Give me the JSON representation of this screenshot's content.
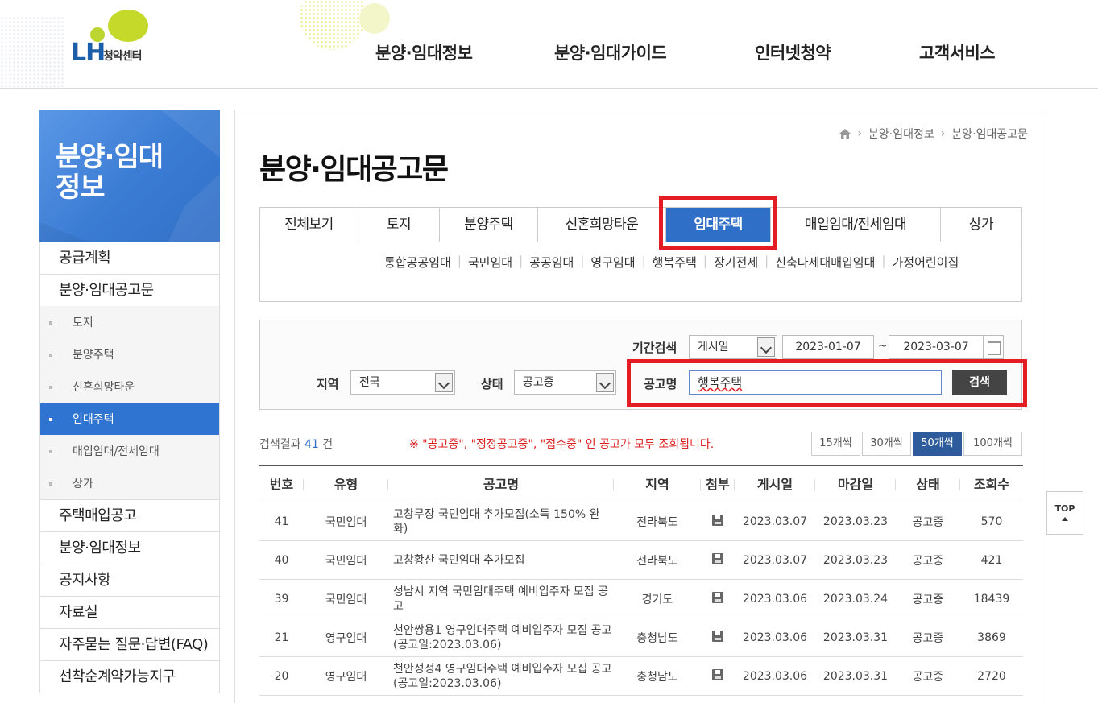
{
  "header": {
    "logo_brand": "LH",
    "logo_sub": "청약센터",
    "nav": [
      "분양·임대정보",
      "분양·임대가이드",
      "인터넷청약",
      "고객서비스"
    ]
  },
  "sidebar": {
    "title_line1": "분양·임대",
    "title_line2": "정보",
    "items": [
      {
        "label": "공급계획"
      },
      {
        "label": "분양·임대공고문"
      },
      {
        "label": "토지"
      },
      {
        "label": "분양주택"
      },
      {
        "label": "신혼희망타운"
      },
      {
        "label": "임대주택"
      },
      {
        "label": "매입임대/전세임대"
      },
      {
        "label": "상가"
      },
      {
        "label": "주택매입공고"
      },
      {
        "label": "분양·임대정보"
      },
      {
        "label": "공지사항"
      },
      {
        "label": "자료실"
      },
      {
        "label": "자주묻는 질문·답변(FAQ)"
      },
      {
        "label": "선착순계약가능지구"
      }
    ]
  },
  "breadcrumb": [
    "분양·임대정보",
    "분양·임대공고문"
  ],
  "page_title": "분양·임대공고문",
  "tabs": [
    "전체보기",
    "토지",
    "분양주택",
    "신혼희망타운",
    "임대주택",
    "매입임대/전세임대",
    "상가"
  ],
  "active_tab": "임대주택",
  "subtabs": [
    "통합공공임대",
    "국민임대",
    "공공임대",
    "영구임대",
    "행복주택",
    "장기전세",
    "신축다세대매입임대",
    "가정어린이집"
  ],
  "search": {
    "period_label": "기간검색",
    "period_type": "게시일",
    "date_from": "2023-01-07",
    "date_sep": "~",
    "date_to": "2023-03-07",
    "region_label": "지역",
    "region_value": "전국",
    "status_label": "상태",
    "status_value": "공고중",
    "name_label": "공고명",
    "name_value": "행복주택",
    "button": "검색"
  },
  "result": {
    "prefix": "검색결과",
    "count": "41",
    "suffix": "건",
    "notice": "※ \"공고중\", \"정정공고중\", \"접수중\" 인 공고가 모두 조회됩니다."
  },
  "per_page": [
    "15개씩",
    "30개씩",
    "50개씩",
    "100개씩"
  ],
  "per_page_active": "50개씩",
  "table": {
    "headers": [
      "번호",
      "유형",
      "공고명",
      "지역",
      "첨부",
      "게시일",
      "마감일",
      "상태",
      "조회수"
    ],
    "rows": [
      {
        "no": "41",
        "type": "국민임대",
        "title": "고창무장 국민임대 추가모집(소득 150% 완화)",
        "region": "전라북도",
        "posted": "2023.03.07",
        "deadline": "2023.03.23",
        "status": "공고중",
        "views": "570"
      },
      {
        "no": "40",
        "type": "국민임대",
        "title": "고창황산 국민임대 추가모집",
        "region": "전라북도",
        "posted": "2023.03.07",
        "deadline": "2023.03.23",
        "status": "공고중",
        "views": "421"
      },
      {
        "no": "39",
        "type": "국민임대",
        "title": "성남시 지역 국민임대주택 예비입주자 모집 공고",
        "region": "경기도",
        "posted": "2023.03.06",
        "deadline": "2023.03.24",
        "status": "공고중",
        "views": "18439"
      },
      {
        "no": "21",
        "type": "영구임대",
        "title": "천안쌍용1 영구임대주택 예비입주자 모집 공고(공고일:2023.03.06)",
        "region": "충청남도",
        "posted": "2023.03.06",
        "deadline": "2023.03.31",
        "status": "공고중",
        "views": "3869"
      },
      {
        "no": "20",
        "type": "영구임대",
        "title": "천안성정4 영구임대주택 예비입주자 모집 공고(공고일:2023.03.06)",
        "region": "충청남도",
        "posted": "2023.03.06",
        "deadline": "2023.03.31",
        "status": "공고중",
        "views": "2720"
      }
    ]
  },
  "top_button": "TOP",
  "colors": {
    "accent": "#2f6fc7",
    "highlight": "#e41d24"
  }
}
